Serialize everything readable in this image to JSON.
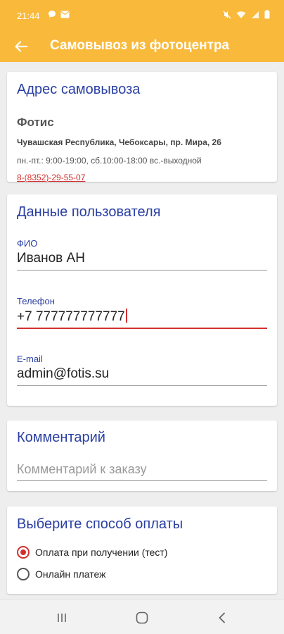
{
  "status_bar": {
    "time": "21:44",
    "left_icons": [
      "chat-bubble-icon",
      "mail-icon"
    ],
    "right_icons": [
      "mute-icon",
      "wifi-icon",
      "signal-icon",
      "battery-icon"
    ]
  },
  "app_bar": {
    "title": "Самовывоз из фотоцентра",
    "back_icon": "arrow-left-icon",
    "color": "#f9b93b"
  },
  "address_card": {
    "title": "Адрес самовывоза",
    "shop_name": "Фотис",
    "address": "Чувашская Республика, Чебоксары, пр. Мира, 26",
    "hours": "пн.-пт.: 9:00-19:00, сб.10:00-18:00 вс.-выходной",
    "phone": "8-(8352)-29-55-07"
  },
  "user_card": {
    "title": "Данные пользователя",
    "fields": [
      {
        "label": "ФИО",
        "value": "Иванов АН"
      },
      {
        "label": "Телефон",
        "value": "+7 777777777777"
      },
      {
        "label": "E-mail",
        "value": "admin@fotis.su"
      }
    ]
  },
  "comment_card": {
    "title": "Комментарий",
    "placeholder": "Комментарий к заказу"
  },
  "payment_card": {
    "title": "Выберите способ оплаты",
    "options": [
      {
        "label": "Оплата при получении (тест)",
        "selected": true
      },
      {
        "label": "Онлайн платеж",
        "selected": false
      }
    ]
  },
  "nav_bar": {
    "buttons": [
      "recent-apps-icon",
      "home-icon",
      "back-icon"
    ]
  },
  "colors": {
    "accent": "#f9b93b",
    "title_blue": "#2a3fa3",
    "error_red": "#d32f2f"
  }
}
